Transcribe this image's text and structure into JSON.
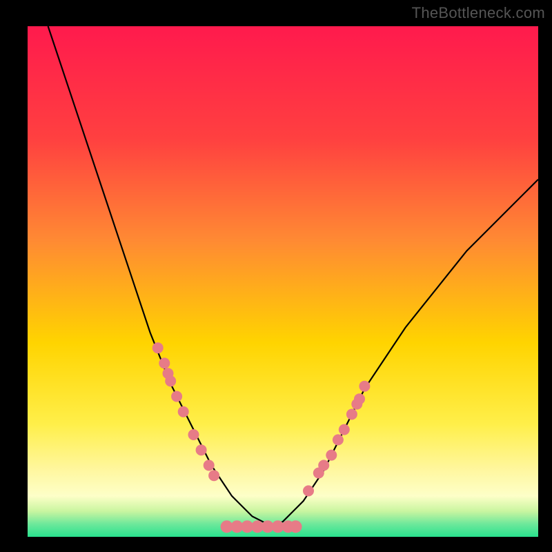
{
  "attribution": "TheBottleneck.com",
  "chart_data": {
    "type": "line",
    "title": "",
    "xlabel": "",
    "ylabel": "",
    "xlim": [
      0,
      100
    ],
    "ylim": [
      0,
      100
    ],
    "background_gradient": {
      "top": "#ff1a4d",
      "mid_upper": "#ff8a33",
      "mid": "#ffe000",
      "mid_lower": "#fff78a",
      "near_bottom": "#9ef08f",
      "bottom": "#29e28e"
    },
    "series": [
      {
        "name": "bottleneck-curve-left",
        "x": [
          4,
          6,
          8,
          10,
          12,
          14,
          16,
          18,
          20,
          22,
          24,
          26,
          28,
          30,
          32,
          34,
          36,
          38,
          40,
          42,
          44,
          46,
          48
        ],
        "values": [
          100,
          94,
          88,
          82,
          76,
          70,
          64,
          58,
          52,
          46,
          40,
          35,
          30,
          26,
          22,
          18,
          14,
          11,
          8,
          6,
          4,
          3,
          2
        ]
      },
      {
        "name": "bottleneck-curve-right",
        "x": [
          48,
          50,
          52,
          54,
          56,
          58,
          60,
          62,
          64,
          66,
          70,
          74,
          78,
          82,
          86,
          90,
          94,
          98,
          100
        ],
        "values": [
          2,
          3,
          5,
          7,
          10,
          13,
          17,
          21,
          25,
          29,
          35,
          41,
          46,
          51,
          56,
          60,
          64,
          68,
          70
        ]
      }
    ],
    "markers_left": {
      "name": "highlight-left",
      "color": "#e77b87",
      "x": [
        25.5,
        26.8,
        27.5,
        28.0,
        29.2,
        30.5,
        32.5,
        34.0,
        35.5,
        36.5
      ],
      "values": [
        37.0,
        34.0,
        32.0,
        30.5,
        27.5,
        24.5,
        20.0,
        17.0,
        14.0,
        12.0
      ]
    },
    "markers_right": {
      "name": "highlight-right",
      "color": "#e77b87",
      "x": [
        55.0,
        57.0,
        58.0,
        59.5,
        60.8,
        62.0,
        63.5,
        64.5,
        65.0,
        66.0
      ],
      "values": [
        9.0,
        12.5,
        14.0,
        16.0,
        19.0,
        21.0,
        24.0,
        26.0,
        27.0,
        29.5
      ]
    },
    "flat_bottom": {
      "name": "zero-band",
      "color": "#e77b87",
      "x": [
        39.0,
        41.0,
        43.0,
        45.0,
        47.0,
        49.0,
        51.0,
        52.5
      ],
      "values": [
        2.0,
        2.0,
        2.0,
        2.0,
        2.0,
        2.0,
        2.0,
        2.0
      ]
    }
  }
}
